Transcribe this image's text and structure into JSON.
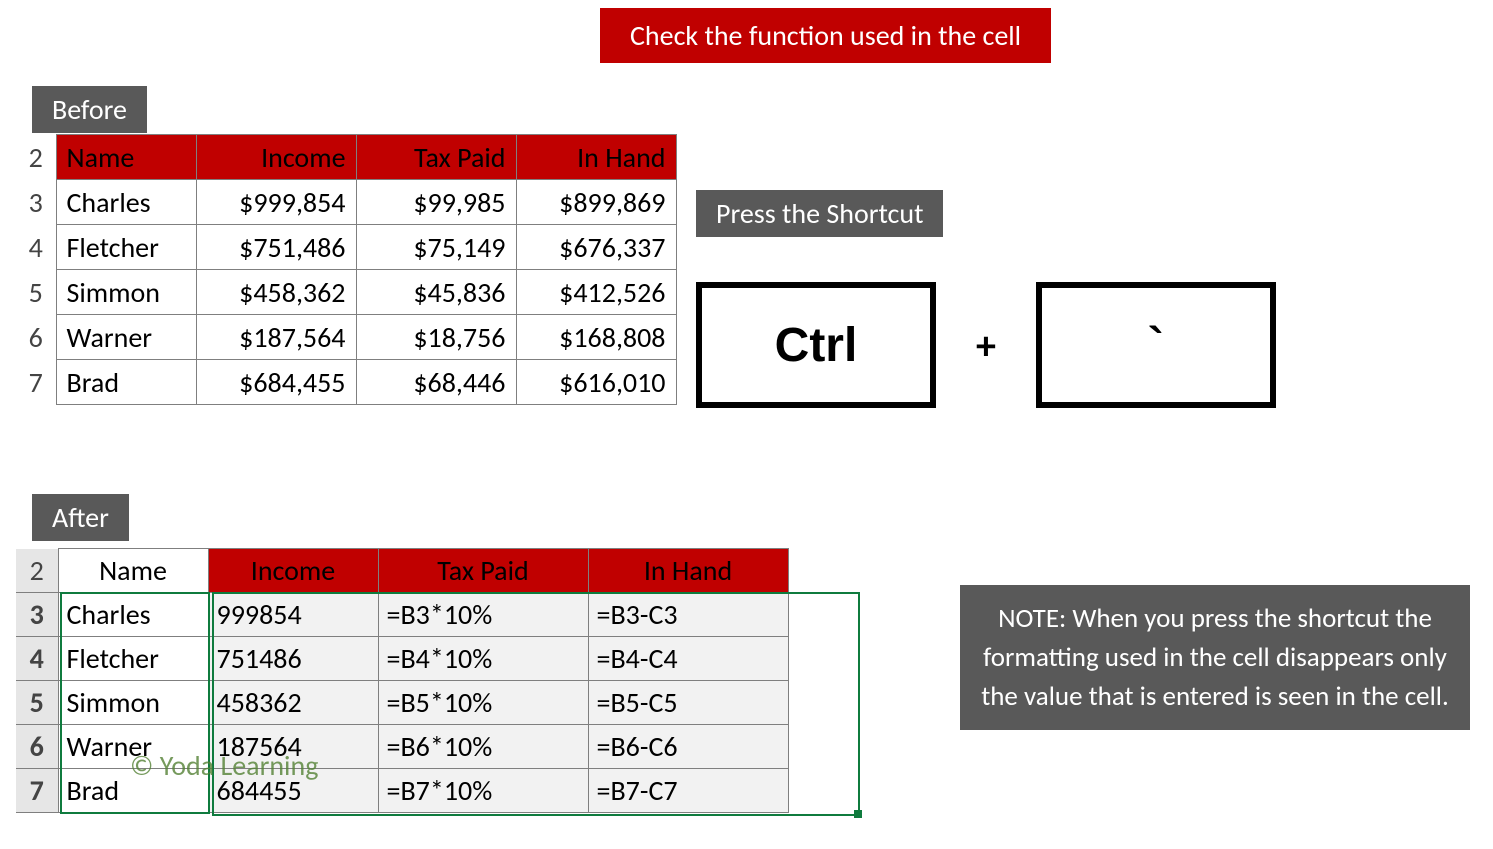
{
  "banner": "Check the function used in the cell",
  "labels": {
    "before": "Before",
    "after": "After",
    "shortcut": "Press the Shortcut"
  },
  "headers": [
    "Name",
    "Income",
    "Tax Paid",
    "In Hand"
  ],
  "before_rows": [
    {
      "n": "2"
    },
    {
      "n": "3",
      "name": "Charles",
      "income": "$999,854",
      "tax": "$99,985",
      "hand": "$899,869"
    },
    {
      "n": "4",
      "name": "Fletcher",
      "income": "$751,486",
      "tax": "$75,149",
      "hand": "$676,337"
    },
    {
      "n": "5",
      "name": "Simmon",
      "income": "$458,362",
      "tax": "$45,836",
      "hand": "$412,526"
    },
    {
      "n": "6",
      "name": "Warner",
      "income": "$187,564",
      "tax": "$18,756",
      "hand": "$168,808"
    },
    {
      "n": "7",
      "name": "Brad",
      "income": "$684,455",
      "tax": "$68,446",
      "hand": "$616,010"
    }
  ],
  "after_rows": [
    {
      "n": "2"
    },
    {
      "n": "3",
      "name": "Charles",
      "income": "999854",
      "tax": "=B3*10%",
      "hand": "=B3-C3"
    },
    {
      "n": "4",
      "name": "Fletcher",
      "income": "751486",
      "tax": "=B4*10%",
      "hand": "=B4-C4"
    },
    {
      "n": "5",
      "name": "Simmon",
      "income": "458362",
      "tax": "=B5*10%",
      "hand": "=B5-C5"
    },
    {
      "n": "6",
      "name": "Warner",
      "income": "187564",
      "tax": "=B6*10%",
      "hand": "=B6-C6"
    },
    {
      "n": "7",
      "name": "Brad",
      "income": "684455",
      "tax": "=B7*10%",
      "hand": "=B7-C7"
    }
  ],
  "keys": {
    "k1": "Ctrl",
    "plus": "+",
    "k2": "`"
  },
  "note": "NOTE: When you press the shortcut the formatting used in the cell disappears only the value that is entered is seen in the cell.",
  "watermark": "© Yoda Learning"
}
